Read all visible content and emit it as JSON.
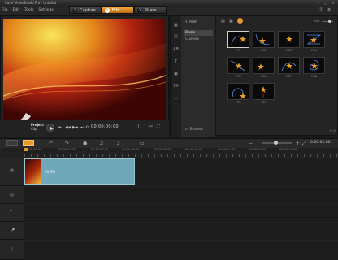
{
  "window": {
    "title": "Corel VideoStudio Pro - Untitled",
    "buttons": [
      "–",
      "□",
      "×"
    ]
  },
  "menu": {
    "items": [
      "File",
      "Edit",
      "Tools",
      "Settings"
    ]
  },
  "steps": [
    {
      "num": "1",
      "label": "Capture",
      "active": false
    },
    {
      "num": "2",
      "label": "Edit",
      "active": true
    },
    {
      "num": "3",
      "label": "Share",
      "active": false
    }
  ],
  "player": {
    "project_label": "Project",
    "clip_label": "Clip",
    "timecode": "00:00:00:00",
    "progress": 0.0
  },
  "library": {
    "add_label": "Add",
    "categories": [
      {
        "label": "Basic",
        "selected": true
      },
      {
        "label": "Custom",
        "selected": false
      }
    ],
    "browse_label": "Browse",
    "thumbs": [
      {
        "label": "P01",
        "selected": true
      },
      {
        "label": "P02",
        "selected": false
      },
      {
        "label": "P03",
        "selected": false
      },
      {
        "label": "P04",
        "selected": false
      },
      {
        "label": "P05",
        "selected": false
      },
      {
        "label": "P06",
        "selected": false
      },
      {
        "label": "P07",
        "selected": false
      },
      {
        "label": "P08",
        "selected": false
      },
      {
        "label": "P09",
        "selected": false
      },
      {
        "label": "P10",
        "selected": false
      }
    ]
  },
  "timeline": {
    "timecode": "0:00:01:00",
    "ruler": [
      "00:00:00:00",
      "00:00:02:00",
      "00:00:04:00",
      "00:00:06:00",
      "00:00:08:00",
      "00:00:10:00",
      "00:00:12:00",
      "00:00:14:00",
      "00:00:16:00"
    ],
    "clip_name": "03.JPG"
  },
  "colors": {
    "accent": "#e69a2c",
    "clip": "#6fa8b8"
  }
}
